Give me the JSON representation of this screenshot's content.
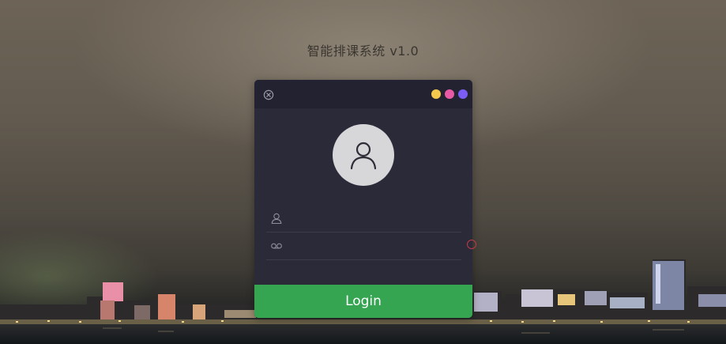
{
  "app": {
    "title": "智能排课系统 v1.0"
  },
  "dialog": {
    "close_icon": "close-circle-icon",
    "window_dots": [
      {
        "name": "minimize",
        "color": "#f2c94c"
      },
      {
        "name": "maximize",
        "color": "#e85aa6"
      },
      {
        "name": "extra",
        "color": "#7b5cf5"
      }
    ],
    "avatar_icon": "user-avatar-icon"
  },
  "form": {
    "username": {
      "icon": "user-icon",
      "value": "",
      "placeholder": ""
    },
    "password": {
      "icon": "key-icon",
      "value": "",
      "placeholder": ""
    },
    "login_label": "Login"
  },
  "colors": {
    "dialog_bg": "#2b2a38",
    "titlebar_bg": "#232230",
    "login_bg": "#35a552",
    "avatar_bg": "#d7d6d9"
  }
}
